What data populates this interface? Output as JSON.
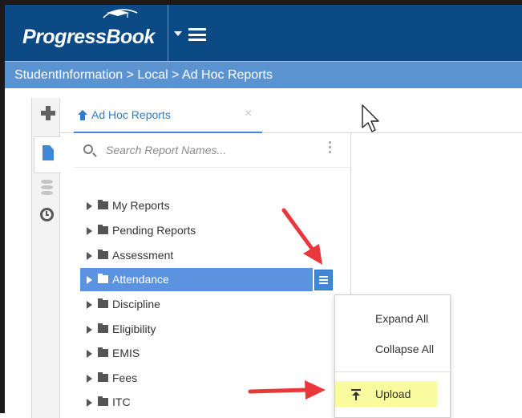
{
  "app": {
    "logo_text": "ProgressBook"
  },
  "breadcrumb": "StudentInformation > Local > Ad Hoc Reports",
  "tab": {
    "label": "Ad Hoc Reports",
    "close_glyph": "×"
  },
  "search": {
    "placeholder": "Search Report Names..."
  },
  "tree": {
    "items": [
      {
        "label": "My Reports"
      },
      {
        "label": "Pending Reports"
      },
      {
        "label": "Assessment"
      },
      {
        "label": "Attendance",
        "selected": true
      },
      {
        "label": "Discipline"
      },
      {
        "label": "Eligibility"
      },
      {
        "label": "EMIS"
      },
      {
        "label": "Fees"
      },
      {
        "label": "ITC"
      }
    ]
  },
  "context_menu": {
    "expand_all": "Expand All",
    "collapse_all": "Collapse All",
    "upload": "Upload"
  },
  "colors": {
    "header": "#0c4a86",
    "breadcrumb_bar": "#5b93d1",
    "selected_row": "#5b93e0",
    "accent": "#3e88d6",
    "highlight": "#fafa9e",
    "annotation_arrow": "#e8383b"
  },
  "icons": [
    "graduation-cap-icon",
    "chevron-down-icon",
    "hamburger-icon",
    "plus-icon",
    "document-icon",
    "database-icon",
    "clock-icon",
    "home-icon",
    "close-icon",
    "search-icon",
    "kebab-icon",
    "folder-icon",
    "upload-icon",
    "mouse-pointer-icon"
  ]
}
